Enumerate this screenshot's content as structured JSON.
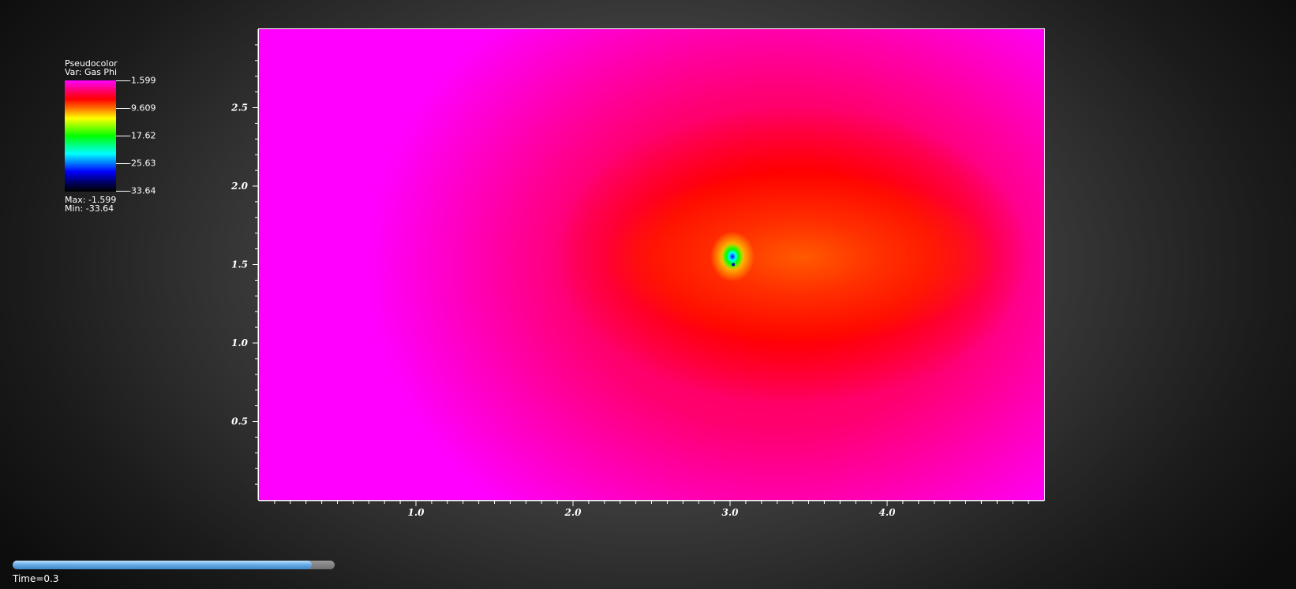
{
  "legend": {
    "plot_type": "Pseudocolor",
    "var_label": "Var: Gas Phi",
    "ticks": [
      "-1.599",
      "-9.609",
      "-17.62",
      "-25.63",
      "-33.64"
    ],
    "max_label": "Max: -1.599",
    "min_label": "Min: -33.64",
    "colormap": [
      "#ff00ff",
      "#ff0000",
      "#ffff00",
      "#00ff00",
      "#00ffff",
      "#0000ff",
      "#000000"
    ]
  },
  "chart_data": {
    "type": "heatmap",
    "variable": "Gas Phi",
    "value_range": [
      -33.64,
      -1.599
    ],
    "xlim": [
      0,
      5
    ],
    "ylim": [
      0,
      3
    ],
    "x_ticks": [
      1.0,
      2.0,
      3.0,
      4.0
    ],
    "x_tick_labels": [
      "1.0",
      "2.0",
      "3.0",
      "4.0"
    ],
    "y_ticks": [
      0.5,
      1.0,
      1.5,
      2.0,
      2.5
    ],
    "y_tick_labels": [
      "0.5",
      "1.0",
      "1.5",
      "2.0",
      "2.5"
    ],
    "features": [
      {
        "kind": "minimum",
        "x": 3.02,
        "y": 1.5,
        "value": -33.64
      }
    ],
    "background_value": -1.599
  },
  "time": {
    "label": "Time=0.3",
    "slider_fraction": 0.93
  }
}
